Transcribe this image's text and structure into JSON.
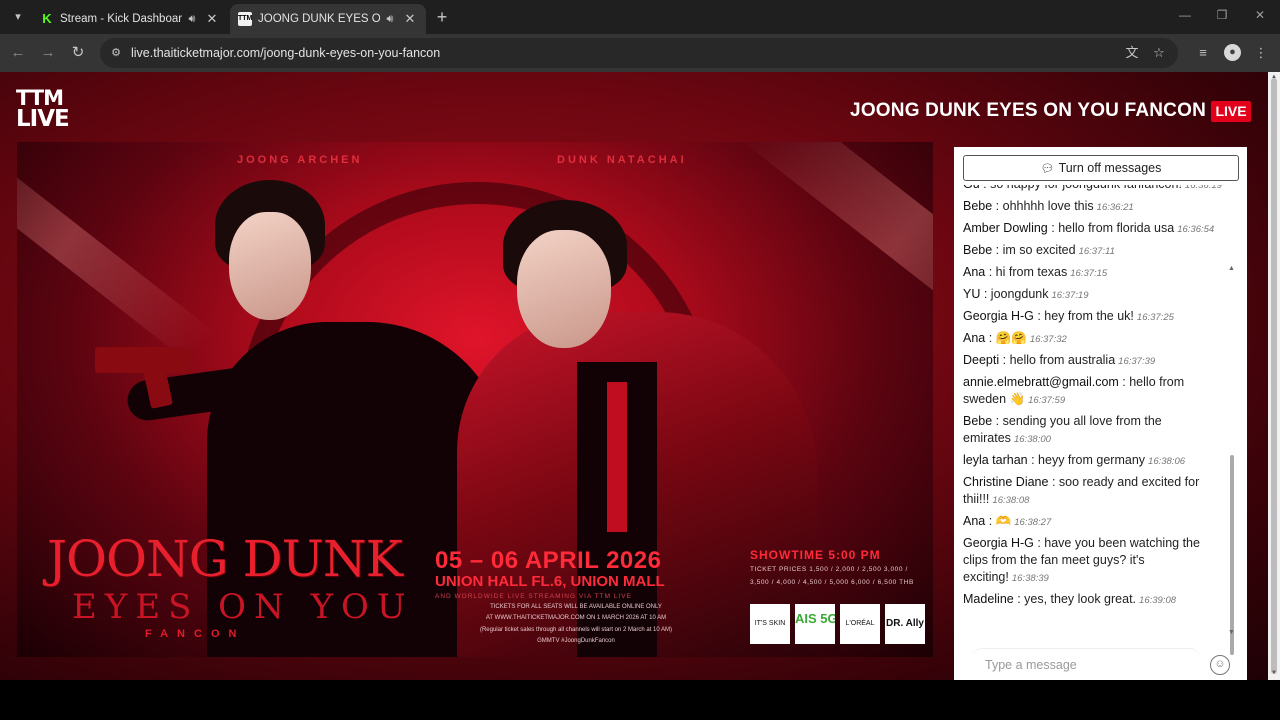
{
  "browser": {
    "tabs": [
      {
        "title": "Stream - Kick Dashboard",
        "favicon": "K"
      },
      {
        "title": "JOONG DUNK EYES ON YO",
        "favicon": "TTM"
      }
    ],
    "url": "live.thaiticketmajor.com/joong-dunk-eyes-on-you-fancon"
  },
  "page": {
    "logo_line1": "TTM",
    "logo_line2": "LIVE",
    "event_title": "JOONG DUNK EYES ON YOU FANCON",
    "live_badge": "LIVE"
  },
  "poster": {
    "name_left": "JOONG ARCHEN",
    "name_right": "DUNK NATACHAI",
    "title": "JOONG DUNK",
    "subtitle": "EYES ON YOU",
    "fancon": "FANCON",
    "date": "05 – 06 APRIL 2026",
    "venue": "UNION HALL FL.6, UNION MALL",
    "streaming": "AND WORLDWIDE LIVE STREAMING VIA TTM LIVE",
    "tickets_line1": "TICKETS FOR ALL SEATS WILL BE AVAILABLE ONLINE ONLY",
    "tickets_line2": "AT WWW.THAITICKETMAJOR.COM ON 1 MARCH 2026 AT 10 AM",
    "tickets_line3": "(Regular ticket sales through all channels will start on 2 March at 10 AM)",
    "social": "GMMTV #JoongDunkFancon",
    "showtime": "SHOWTIME 5:00 PM",
    "prices": "TICKET PRICES 1,500 / 2,000 / 2,500 3,000 / 3,500 / 4,000 / 4,500 / 5,000 6,000 / 6,500 THB",
    "sponsors": [
      "IT'S SKIN",
      "AIS 5G",
      "L'ORÉAL",
      "DR. Ally"
    ]
  },
  "chat": {
    "toggle_label": "Turn off messages",
    "input_placeholder": "Type a message",
    "messages": [
      {
        "user": "Gu",
        "text": "so happy for joongdunk fanfancon!",
        "time": "16:36:19"
      },
      {
        "user": "Bebe",
        "text": "ohhhhh love this",
        "time": "16:36:21"
      },
      {
        "user": "Amber Dowling",
        "text": "hello from florida usa",
        "time": "16:36:54"
      },
      {
        "user": "Bebe",
        "text": "im so excited",
        "time": "16:37:11"
      },
      {
        "user": "Ana",
        "text": "hi from texas",
        "time": "16:37:15"
      },
      {
        "user": "YU",
        "text": "joongdunk",
        "time": "16:37:19"
      },
      {
        "user": "Georgia H-G",
        "text": "hey from the uk!",
        "time": "16:37:25"
      },
      {
        "user": "Ana",
        "text": "🤗🤗",
        "time": "16:37:32"
      },
      {
        "user": "Deepti",
        "text": "hello from australia",
        "time": "16:37:39"
      },
      {
        "user": "annie.elmebratt@gmail.com",
        "text": "hello from sweden 👋",
        "time": "16:37:59"
      },
      {
        "user": "Bebe",
        "text": "sending you all love from the emirates",
        "time": "16:38:00"
      },
      {
        "user": "leyla tarhan",
        "text": "heyy from germany",
        "time": "16:38:06"
      },
      {
        "user": "Christine Diane",
        "text": "soo ready and excited for thii!!!",
        "time": "16:38:08"
      },
      {
        "user": "Ana",
        "text": "🫶",
        "time": "16:38:27"
      },
      {
        "user": "Georgia H-G",
        "text": "have you been watching the clips from the fan meet guys? it's exciting!",
        "time": "16:38:39"
      },
      {
        "user": "Madeline",
        "text": "yes, they look great.",
        "time": "16:39:08"
      }
    ]
  }
}
